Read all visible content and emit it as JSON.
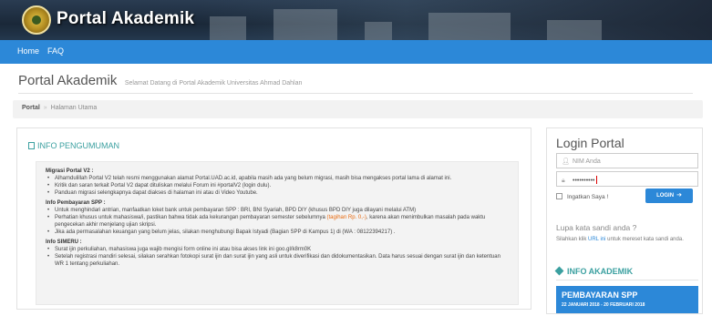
{
  "header": {
    "brand": "Portal Akademik"
  },
  "nav": {
    "items": [
      "Home",
      "FAQ"
    ]
  },
  "page": {
    "title": "Portal Akademik",
    "subtitle": "Selamat Datang di Portal Akademik Universitas Ahmad Dahlan"
  },
  "breadcrumb": {
    "root": "Portal",
    "sep": "»",
    "current": "Halaman Utama"
  },
  "info_pengumuman": {
    "heading": "INFO PENGUMUMAN",
    "sections": [
      {
        "title": "Migrasi Portal V2 :",
        "items": [
          "Alhamdulillah Portal V2 telah resmi menggunakan alamat Portal.UAD.ac.id, apabila masih ada yang belum migrasi, masih bisa mengakses portal lama di alamat ini.",
          "Kritik dan saran terkait Portal V2 dapat dituliskan melalui Forum ini #portalV2 (login dulu).",
          "Panduan migrasi selengkapnya dapat diakses di halaman ini atau di Video Youtube."
        ]
      },
      {
        "title": "Info Pembayaran SPP :",
        "items": [
          "Untuk menghindari antrian, manfaatkan loket bank untuk pembayaran SPP : BRI, BNI Syariah, BPD DIY (khusus BPD DIY juga dilayani melalui ATM)",
          "Perhatian khusus untuk mahasiswa/i, pastikan bahwa tidak ada kekurangan pembayaran semester sebelumnya",
          "Jika ada permasalahan keuangan yang belum jelas, silakan menghubungi Bapak Istyadi (Bagian SPP di Kampus 1) di (WA : 08122394217) ."
        ],
        "highlight": "(tagihan Rp. 0,-)",
        "after_highlight": ", karena akan menimbulkan masalah pada waktu pengecekan akhir menjelang ujian skripsi."
      },
      {
        "title": "Info SIMERU :",
        "items": [
          "Surat ijin perkuliahan, mahasiswa juga wajib mengisi form online ini atau bisa akses link ini goo.gl/k8rm0K",
          "Setelah registrasi mandiri selesai, silakan serahkan fotokopi surat ijin dan surat ijin yang asli untuk diverifikasi dan didokumentasikan. Data harus sesuai dengan surat ijin dan ketentuan WR 1 tentang perkuliahan."
        ]
      }
    ]
  },
  "login": {
    "title": "Login Portal",
    "user_placeholder": "NIM Anda",
    "password_value": "••••••••••",
    "remember_label": "Ingatkan Saya !",
    "button_label": "LOGIN",
    "forgot_title": "Lupa kata sandi anda ?",
    "forgot_desc_pre": "Silahkan klik ",
    "forgot_desc_link": "URL ini",
    "forgot_desc_post": " untuk mereset kata sandi anda."
  },
  "info_akademik": {
    "heading": "INFO AKADEMIK",
    "card_title": "PEMBAYARAN SPP",
    "card_date": "22 JANUARI 2018 - 20 FEBRUARI 2018"
  },
  "colors": {
    "nav_blue": "#2c88d8",
    "teal_heading": "#3ba0a0",
    "highlight_orange": "#e86a10"
  },
  "icons": [
    "logo-emblem",
    "flag-icon",
    "user-icon",
    "lock-icon",
    "arrow-circle-icon",
    "tag-icon"
  ]
}
